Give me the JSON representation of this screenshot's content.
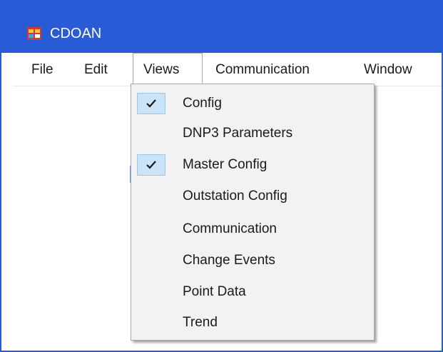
{
  "window": {
    "title": "CDOAN",
    "accent_color": "#2a5bd7",
    "icon": "app-window-icon"
  },
  "menubar": {
    "items": [
      {
        "label": "File"
      },
      {
        "label": "Edit"
      },
      {
        "label": "Views",
        "open": true
      },
      {
        "label": "Communication"
      },
      {
        "label": "Window"
      }
    ]
  },
  "views_menu": {
    "items": [
      {
        "label": "Config",
        "checked": true
      },
      {
        "label": "DNP3 Parameters",
        "checked": false
      },
      {
        "label": "Master Config",
        "checked": true
      },
      {
        "label": "Outstation Config",
        "checked": false
      },
      {
        "label": "Communication",
        "checked": false
      },
      {
        "label": "Change Events",
        "checked": false
      },
      {
        "label": "Point Data",
        "checked": false
      },
      {
        "label": "Trend",
        "checked": false
      }
    ],
    "check_icon": "checkmark-icon"
  }
}
